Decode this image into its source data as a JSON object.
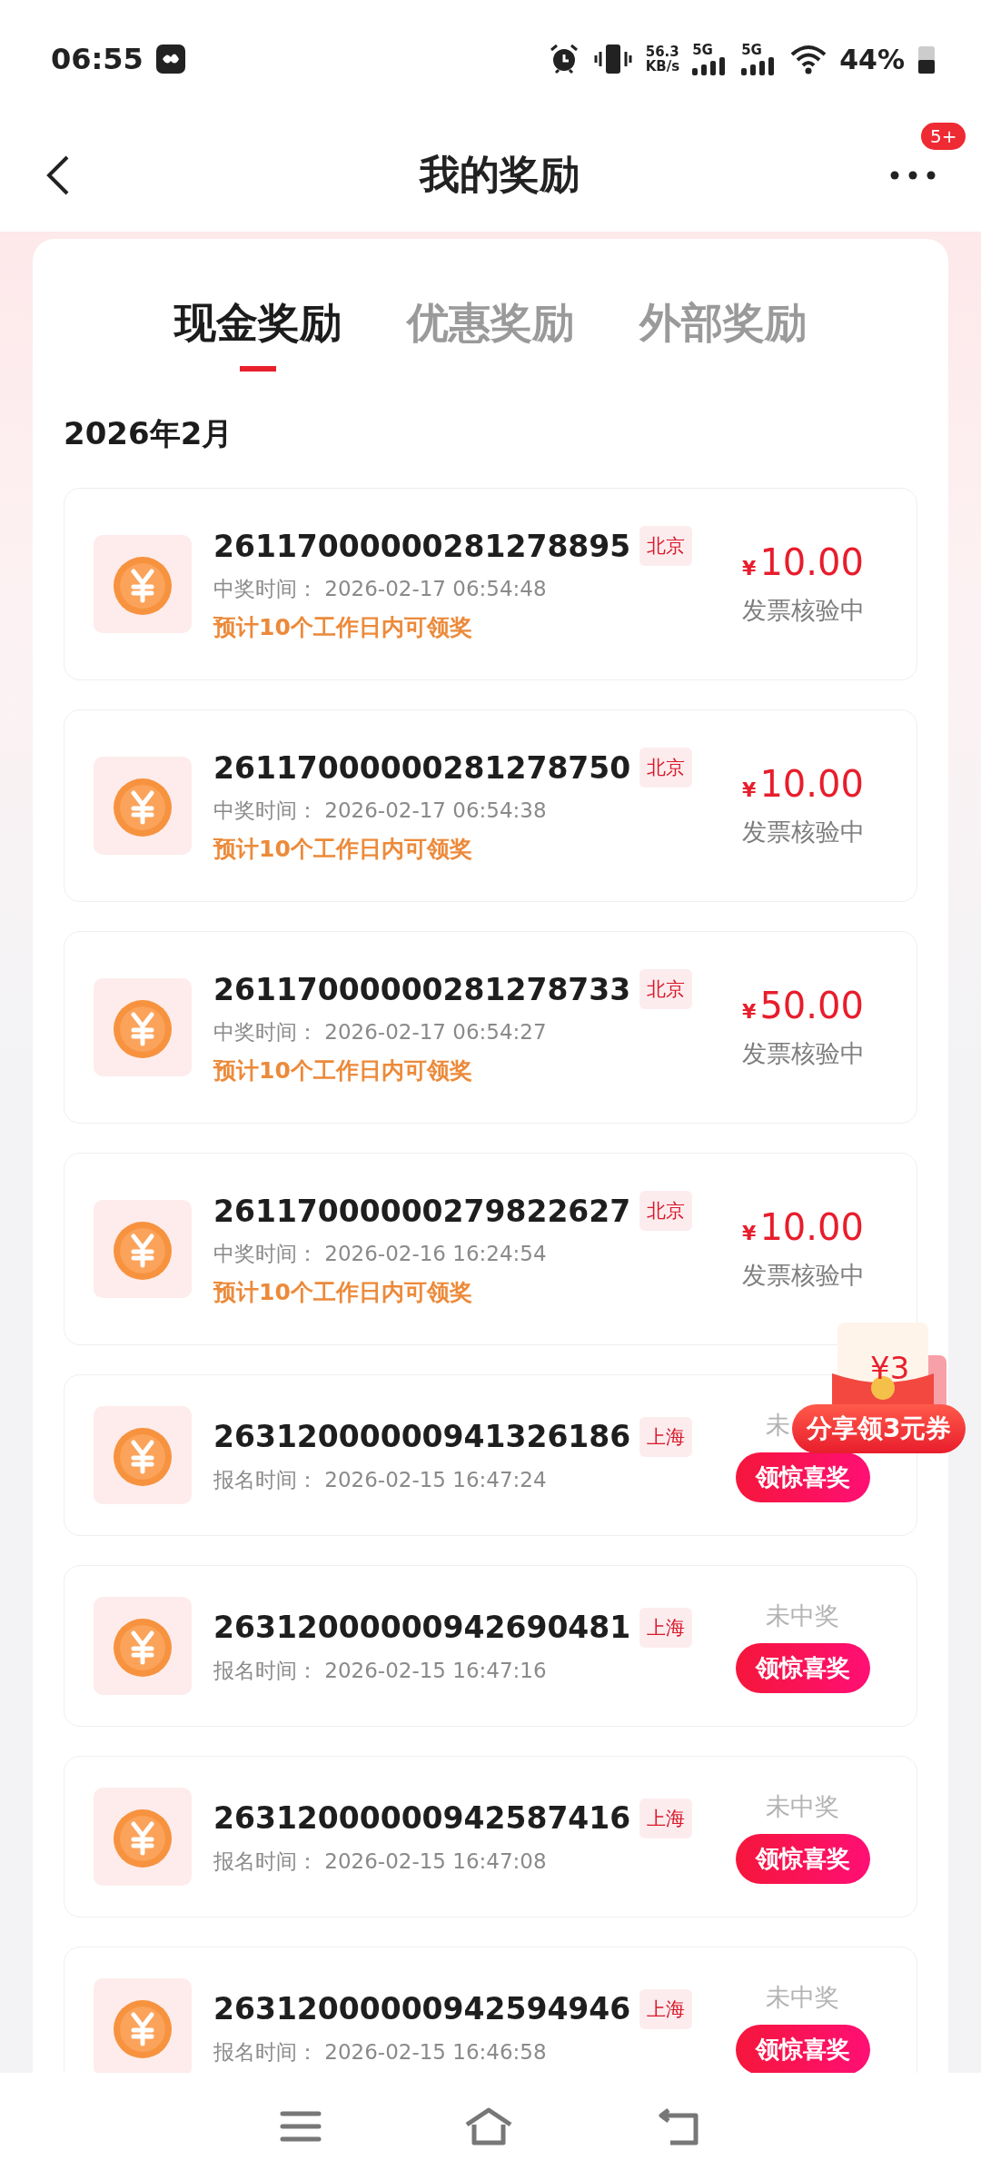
{
  "status_bar": {
    "time": "06:55",
    "net_speed": "56.3",
    "net_unit": "KB/s",
    "sim1": "5G",
    "sim2": "5G",
    "battery": "44%"
  },
  "header": {
    "title": "我的奖励",
    "more_badge": "5+"
  },
  "tabs": [
    {
      "label": "现金奖励",
      "selected": true
    },
    {
      "label": "优惠奖励",
      "selected": false
    },
    {
      "label": "外部奖励",
      "selected": false
    }
  ],
  "month": "2026年2月",
  "records": [
    {
      "kind": "won",
      "id": "26117000000281278895",
      "city": "北京",
      "time_label": "中奖时间：",
      "time": "2026-02-17 06:54:48",
      "note": "预计10个工作日内可领奖",
      "currency": "¥",
      "amount": "10.00",
      "status": "发票核验中"
    },
    {
      "kind": "won",
      "id": "26117000000281278750",
      "city": "北京",
      "time_label": "中奖时间：",
      "time": "2026-02-17 06:54:38",
      "note": "预计10个工作日内可领奖",
      "currency": "¥",
      "amount": "10.00",
      "status": "发票核验中"
    },
    {
      "kind": "won",
      "id": "26117000000281278733",
      "city": "北京",
      "time_label": "中奖时间：",
      "time": "2026-02-17 06:54:27",
      "note": "预计10个工作日内可领奖",
      "currency": "¥",
      "amount": "50.00",
      "status": "发票核验中"
    },
    {
      "kind": "won",
      "id": "26117000000279822627",
      "city": "北京",
      "time_label": "中奖时间：",
      "time": "2026-02-16 16:24:54",
      "note": "预计10个工作日内可领奖",
      "currency": "¥",
      "amount": "10.00",
      "status": "发票核验中"
    },
    {
      "kind": "entered",
      "id": "26312000000941326186",
      "city": "上海",
      "time_label": "报名时间：",
      "time": "2026-02-15 16:47:24",
      "status": "未",
      "button": "领惊喜奖"
    },
    {
      "kind": "entered",
      "id": "26312000000942690481",
      "city": "上海",
      "time_label": "报名时间：",
      "time": "2026-02-15 16:47:16",
      "status": "未中奖",
      "button": "领惊喜奖"
    },
    {
      "kind": "entered",
      "id": "26312000000942587416",
      "city": "上海",
      "time_label": "报名时间：",
      "time": "2026-02-15 16:47:08",
      "status": "未中奖",
      "button": "领惊喜奖"
    },
    {
      "kind": "entered",
      "id": "26312000000942594946",
      "city": "上海",
      "time_label": "报名时间：",
      "time": "2026-02-15 16:46:58",
      "status": "未中奖",
      "button": "领惊喜奖"
    }
  ],
  "promo": {
    "envelope_text": "¥3",
    "label": "分享领3元券"
  }
}
